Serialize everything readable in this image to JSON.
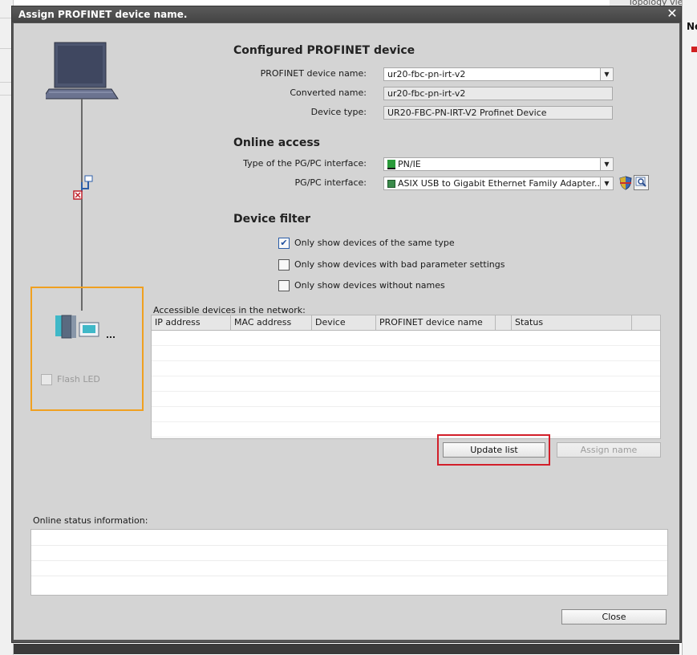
{
  "background": {
    "topology_view_tab": "Topology view",
    "right_header": "Ne"
  },
  "dialog": {
    "title": "Assign PROFINET device name.",
    "close_symbol": "✕"
  },
  "configured": {
    "heading": "Configured PROFINET device",
    "device_name_label": "PROFINET device name:",
    "device_name_value": "ur20-fbc-pn-irt-v2",
    "converted_name_label": "Converted name:",
    "converted_name_value": "ur20-fbc-pn-irt-v2",
    "device_type_label": "Device type:",
    "device_type_value": "UR20-FBC-PN-IRT-V2 Profinet Device"
  },
  "online_access": {
    "heading": "Online access",
    "interface_type_label": "Type of the PG/PC interface:",
    "interface_type_value": "PN/IE",
    "interface_label": "PG/PC interface:",
    "interface_value": "ASIX USB to Gigabit Ethernet Family Adapter..."
  },
  "device_filter": {
    "heading": "Device filter",
    "options": [
      {
        "label": "Only show devices of the same type",
        "checked": true
      },
      {
        "label": "Only show devices with bad parameter settings",
        "checked": false
      },
      {
        "label": "Only show devices without names",
        "checked": false
      }
    ]
  },
  "accessible": {
    "label": "Accessible devices in the network:",
    "columns": [
      "IP address",
      "MAC address",
      "Device",
      "PROFINET device name",
      "",
      "Status"
    ]
  },
  "buttons": {
    "update_list": "Update list",
    "assign_name": "Assign name",
    "close": "Close"
  },
  "flash_led": {
    "label": "Flash LED",
    "checked": false
  },
  "status": {
    "label": "Online status information:"
  },
  "colors": {
    "highlight_red": "#d21f2a",
    "highlight_orange": "#f0a020",
    "dialog_bg": "#d4d4d4"
  }
}
